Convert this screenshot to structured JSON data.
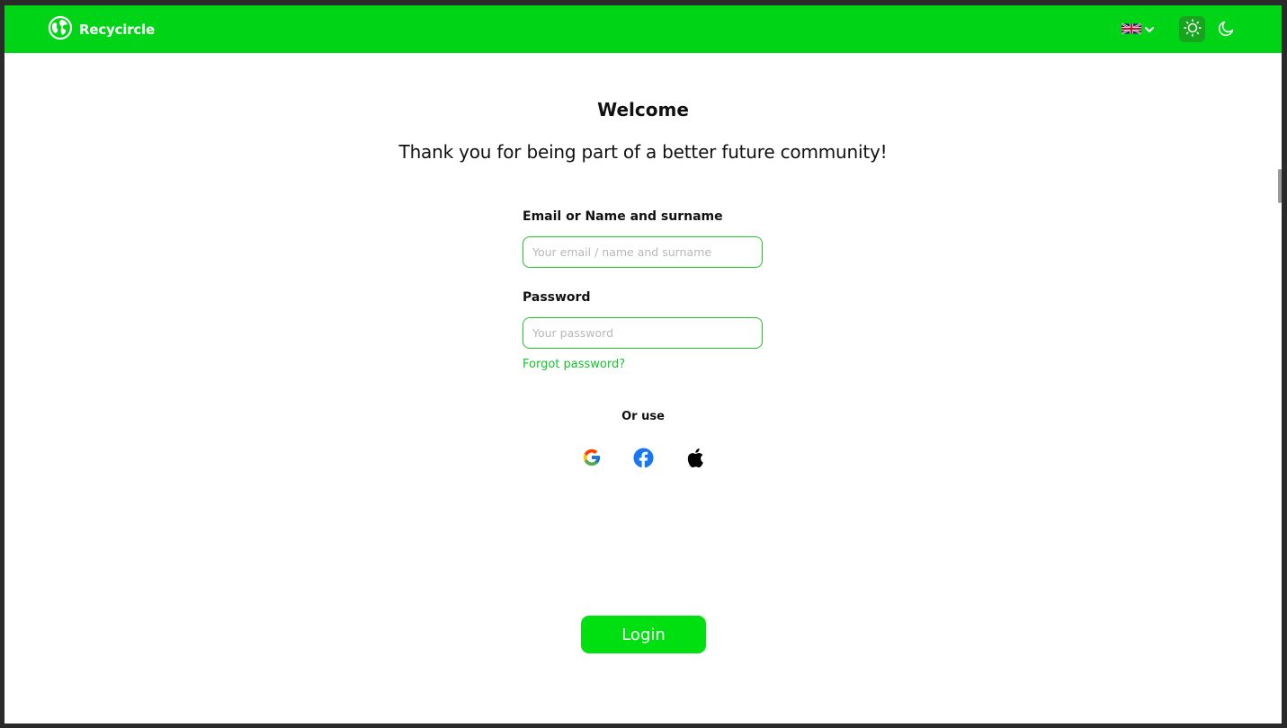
{
  "header": {
    "brand_name": "Recycircle",
    "brand_color": "#00d416",
    "language": {
      "flag": "uk-flag-icon",
      "selected": "English"
    },
    "theme_light_icon": "sun-icon",
    "theme_dark_icon": "moon-icon"
  },
  "main": {
    "title": "Welcome",
    "subtitle": "Thank you for being part of a better future community!",
    "email": {
      "label": "Email or Name and surname",
      "placeholder": "Your email / name and surname",
      "value": ""
    },
    "password": {
      "label": "Password",
      "placeholder": "Your password",
      "value": ""
    },
    "forgot_link": "Forgot password?",
    "or_use": "Or use",
    "social_providers": [
      "google-icon",
      "facebook-icon",
      "apple-icon"
    ],
    "login_button": "Login",
    "accent_color": "#00e010"
  }
}
